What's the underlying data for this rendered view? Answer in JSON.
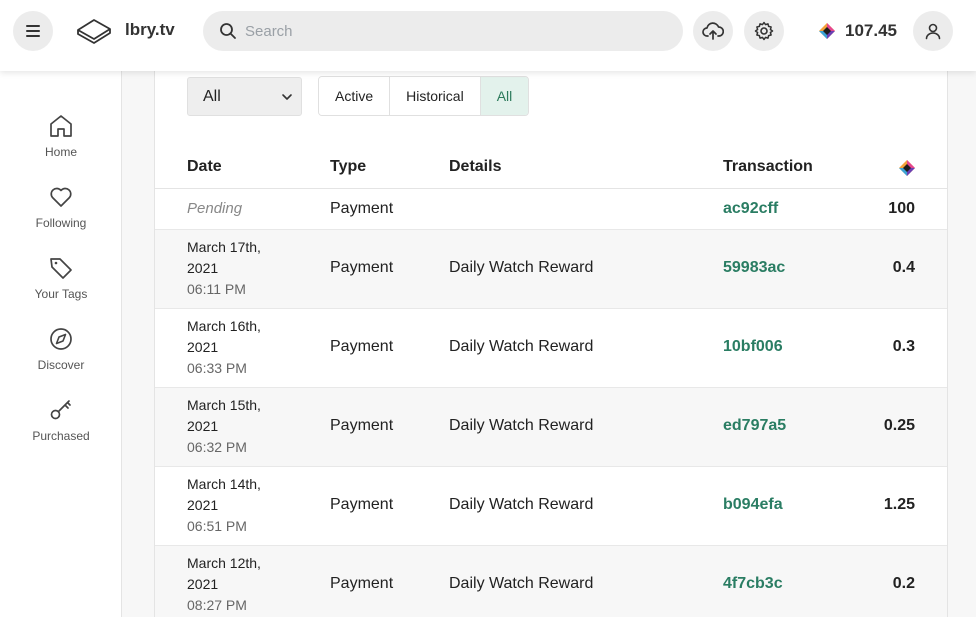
{
  "header": {
    "brand": "lbry.tv",
    "search_placeholder": "Search",
    "balance": "107.45"
  },
  "sidebar": {
    "items": [
      {
        "label": "Home",
        "icon": "home-icon"
      },
      {
        "label": "Following",
        "icon": "heart-icon"
      },
      {
        "label": "Your Tags",
        "icon": "tag-icon"
      },
      {
        "label": "Discover",
        "icon": "compass-icon"
      },
      {
        "label": "Purchased",
        "icon": "key-icon"
      }
    ]
  },
  "filters": {
    "type_select": "All",
    "tabs": [
      "Active",
      "Historical",
      "All"
    ],
    "active_tab": "All"
  },
  "table": {
    "headers": {
      "date": "Date",
      "type": "Type",
      "details": "Details",
      "transaction": "Transaction",
      "amount_icon": "lbc-credits-icon"
    },
    "rows": [
      {
        "date": "Pending",
        "time": "",
        "type": "Payment",
        "details": "",
        "tx": "ac92cff",
        "amount": "100"
      },
      {
        "date": "March 17th, 2021",
        "date_l1": "March 17th,",
        "date_l2": "2021",
        "time": "06:11 PM",
        "type": "Payment",
        "details": "Daily Watch Reward",
        "tx": "59983ac",
        "amount": "0.4"
      },
      {
        "date": "March 16th, 2021",
        "date_l1": "March 16th,",
        "date_l2": "2021",
        "time": "06:33 PM",
        "type": "Payment",
        "details": "Daily Watch Reward",
        "tx": "10bf006",
        "amount": "0.3"
      },
      {
        "date": "March 15th, 2021",
        "date_l1": "March 15th,",
        "date_l2": "2021",
        "time": "06:32 PM",
        "type": "Payment",
        "details": "Daily Watch Reward",
        "tx": "ed797a5",
        "amount": "0.25"
      },
      {
        "date": "March 14th, 2021",
        "date_l1": "March 14th,",
        "date_l2": "2021",
        "time": "06:51 PM",
        "type": "Payment",
        "details": "Daily Watch Reward",
        "tx": "b094efa",
        "amount": "1.25"
      },
      {
        "date": "March 12th, 2021",
        "date_l1": "March 12th,",
        "date_l2": "2021",
        "time": "08:27 PM",
        "type": "Payment",
        "details": "Daily Watch Reward",
        "tx": "4f7cb3c",
        "amount": "0.2"
      }
    ]
  },
  "colors": {
    "accent_green": "#2a7d63",
    "active_tab_bg": "#e3f2ec"
  }
}
